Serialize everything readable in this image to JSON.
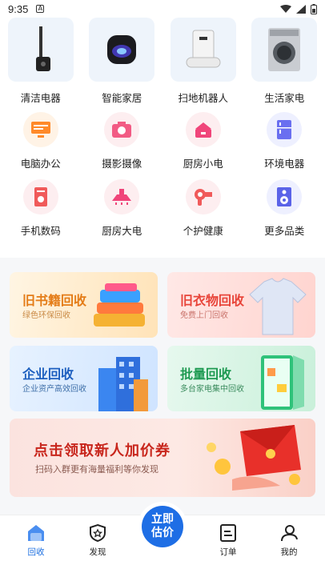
{
  "status": {
    "time": "9:35",
    "notif_icon": "A"
  },
  "top_categories": [
    {
      "label": "清洁电器",
      "icon": "vacuum-icon"
    },
    {
      "label": "智能家居",
      "icon": "smart-speaker-icon"
    },
    {
      "label": "扫地机器人",
      "icon": "robot-vacuum-icon"
    },
    {
      "label": "生活家电",
      "icon": "washing-machine-icon"
    }
  ],
  "row2": [
    {
      "label": "电脑办公",
      "icon": "computer-icon"
    },
    {
      "label": "摄影摄像",
      "icon": "camera-icon"
    },
    {
      "label": "厨房小电",
      "icon": "rice-cooker-icon"
    },
    {
      "label": "环境电器",
      "icon": "fridge-icon"
    }
  ],
  "row3": [
    {
      "label": "手机数码",
      "icon": "phone-icon"
    },
    {
      "label": "厨房大电",
      "icon": "range-hood-icon"
    },
    {
      "label": "个护健康",
      "icon": "hair-dryer-icon"
    },
    {
      "label": "更多品类",
      "icon": "speaker-box-icon"
    }
  ],
  "promos": {
    "books": {
      "title": "旧书籍回收",
      "subtitle": "绿色环保回收"
    },
    "clothes": {
      "title": "旧衣物回收",
      "subtitle": "免费上门回收"
    },
    "enterprise": {
      "title": "企业回收",
      "subtitle": "企业资产高效回收"
    },
    "bulk": {
      "title": "批量回收",
      "subtitle": "多台家电集中回收"
    }
  },
  "banner": {
    "title": "点击领取新人加价券",
    "subtitle": "扫码入群更有海量福利等你发现"
  },
  "tabs": {
    "recycle": "回收",
    "discover": "发现",
    "center_line1": "立即",
    "center_line2": "估价",
    "orders": "订单",
    "mine": "我的"
  },
  "colors": {
    "accent": "#1e6ee5",
    "banner_title": "#c8261c"
  }
}
